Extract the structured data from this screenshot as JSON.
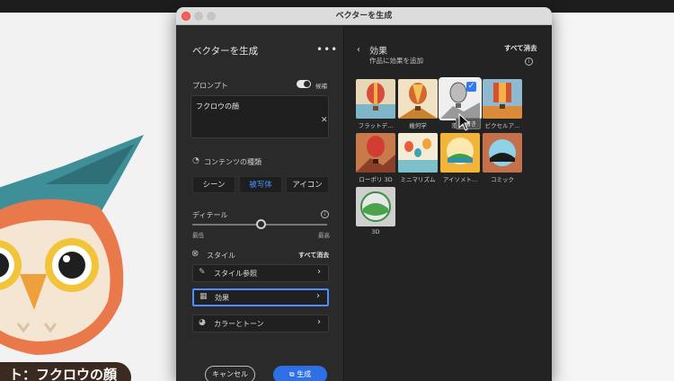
{
  "window": {
    "title": "ベクターを生成"
  },
  "left_panel": {
    "title": "ベクターを生成",
    "prompt_section": {
      "label": "プロンプト",
      "toggle_label": "候補",
      "toggle_on": true,
      "value": "フクロウの顔"
    },
    "content_type": {
      "label": "コンテンツの種類",
      "options": [
        "シーン",
        "被写体",
        "アイコン"
      ],
      "selected": "被写体"
    },
    "detail": {
      "label": "ディテール",
      "min_label": "最低",
      "max_label": "最高",
      "value_percent": 50
    },
    "style": {
      "label": "スタイル",
      "clear_all": "すべて消去",
      "rows": [
        {
          "label": "スタイル参照",
          "icon": "style-reference-icon"
        },
        {
          "label": "効果",
          "icon": "effects-icon",
          "selected": true
        },
        {
          "label": "カラーとトーン",
          "icon": "color-tone-icon"
        }
      ]
    },
    "buttons": {
      "cancel": "キャンセル",
      "generate": "生成"
    }
  },
  "right_panel": {
    "title": "効果",
    "subtitle": "作品に効果を追加",
    "clear_all": "すべて消去",
    "tooltip": "落書き",
    "effects": [
      {
        "label": "フラットデ...",
        "selected": false
      },
      {
        "label": "幾何学",
        "selected": false
      },
      {
        "label": "落書き",
        "selected": true
      },
      {
        "label": "ピクセルア...",
        "selected": false
      },
      {
        "label": "ローポリ 3D",
        "selected": false
      },
      {
        "label": "ミニマリズム",
        "selected": false
      },
      {
        "label": "アイソメト...",
        "selected": false
      },
      {
        "label": "コミック",
        "selected": false
      },
      {
        "label": "3D",
        "selected": false
      }
    ]
  },
  "canvas": {
    "prompt_pill": "ト：フクロウの顔"
  },
  "colors": {
    "accent": "#2f6fe6",
    "selection": "#4c8dff"
  }
}
